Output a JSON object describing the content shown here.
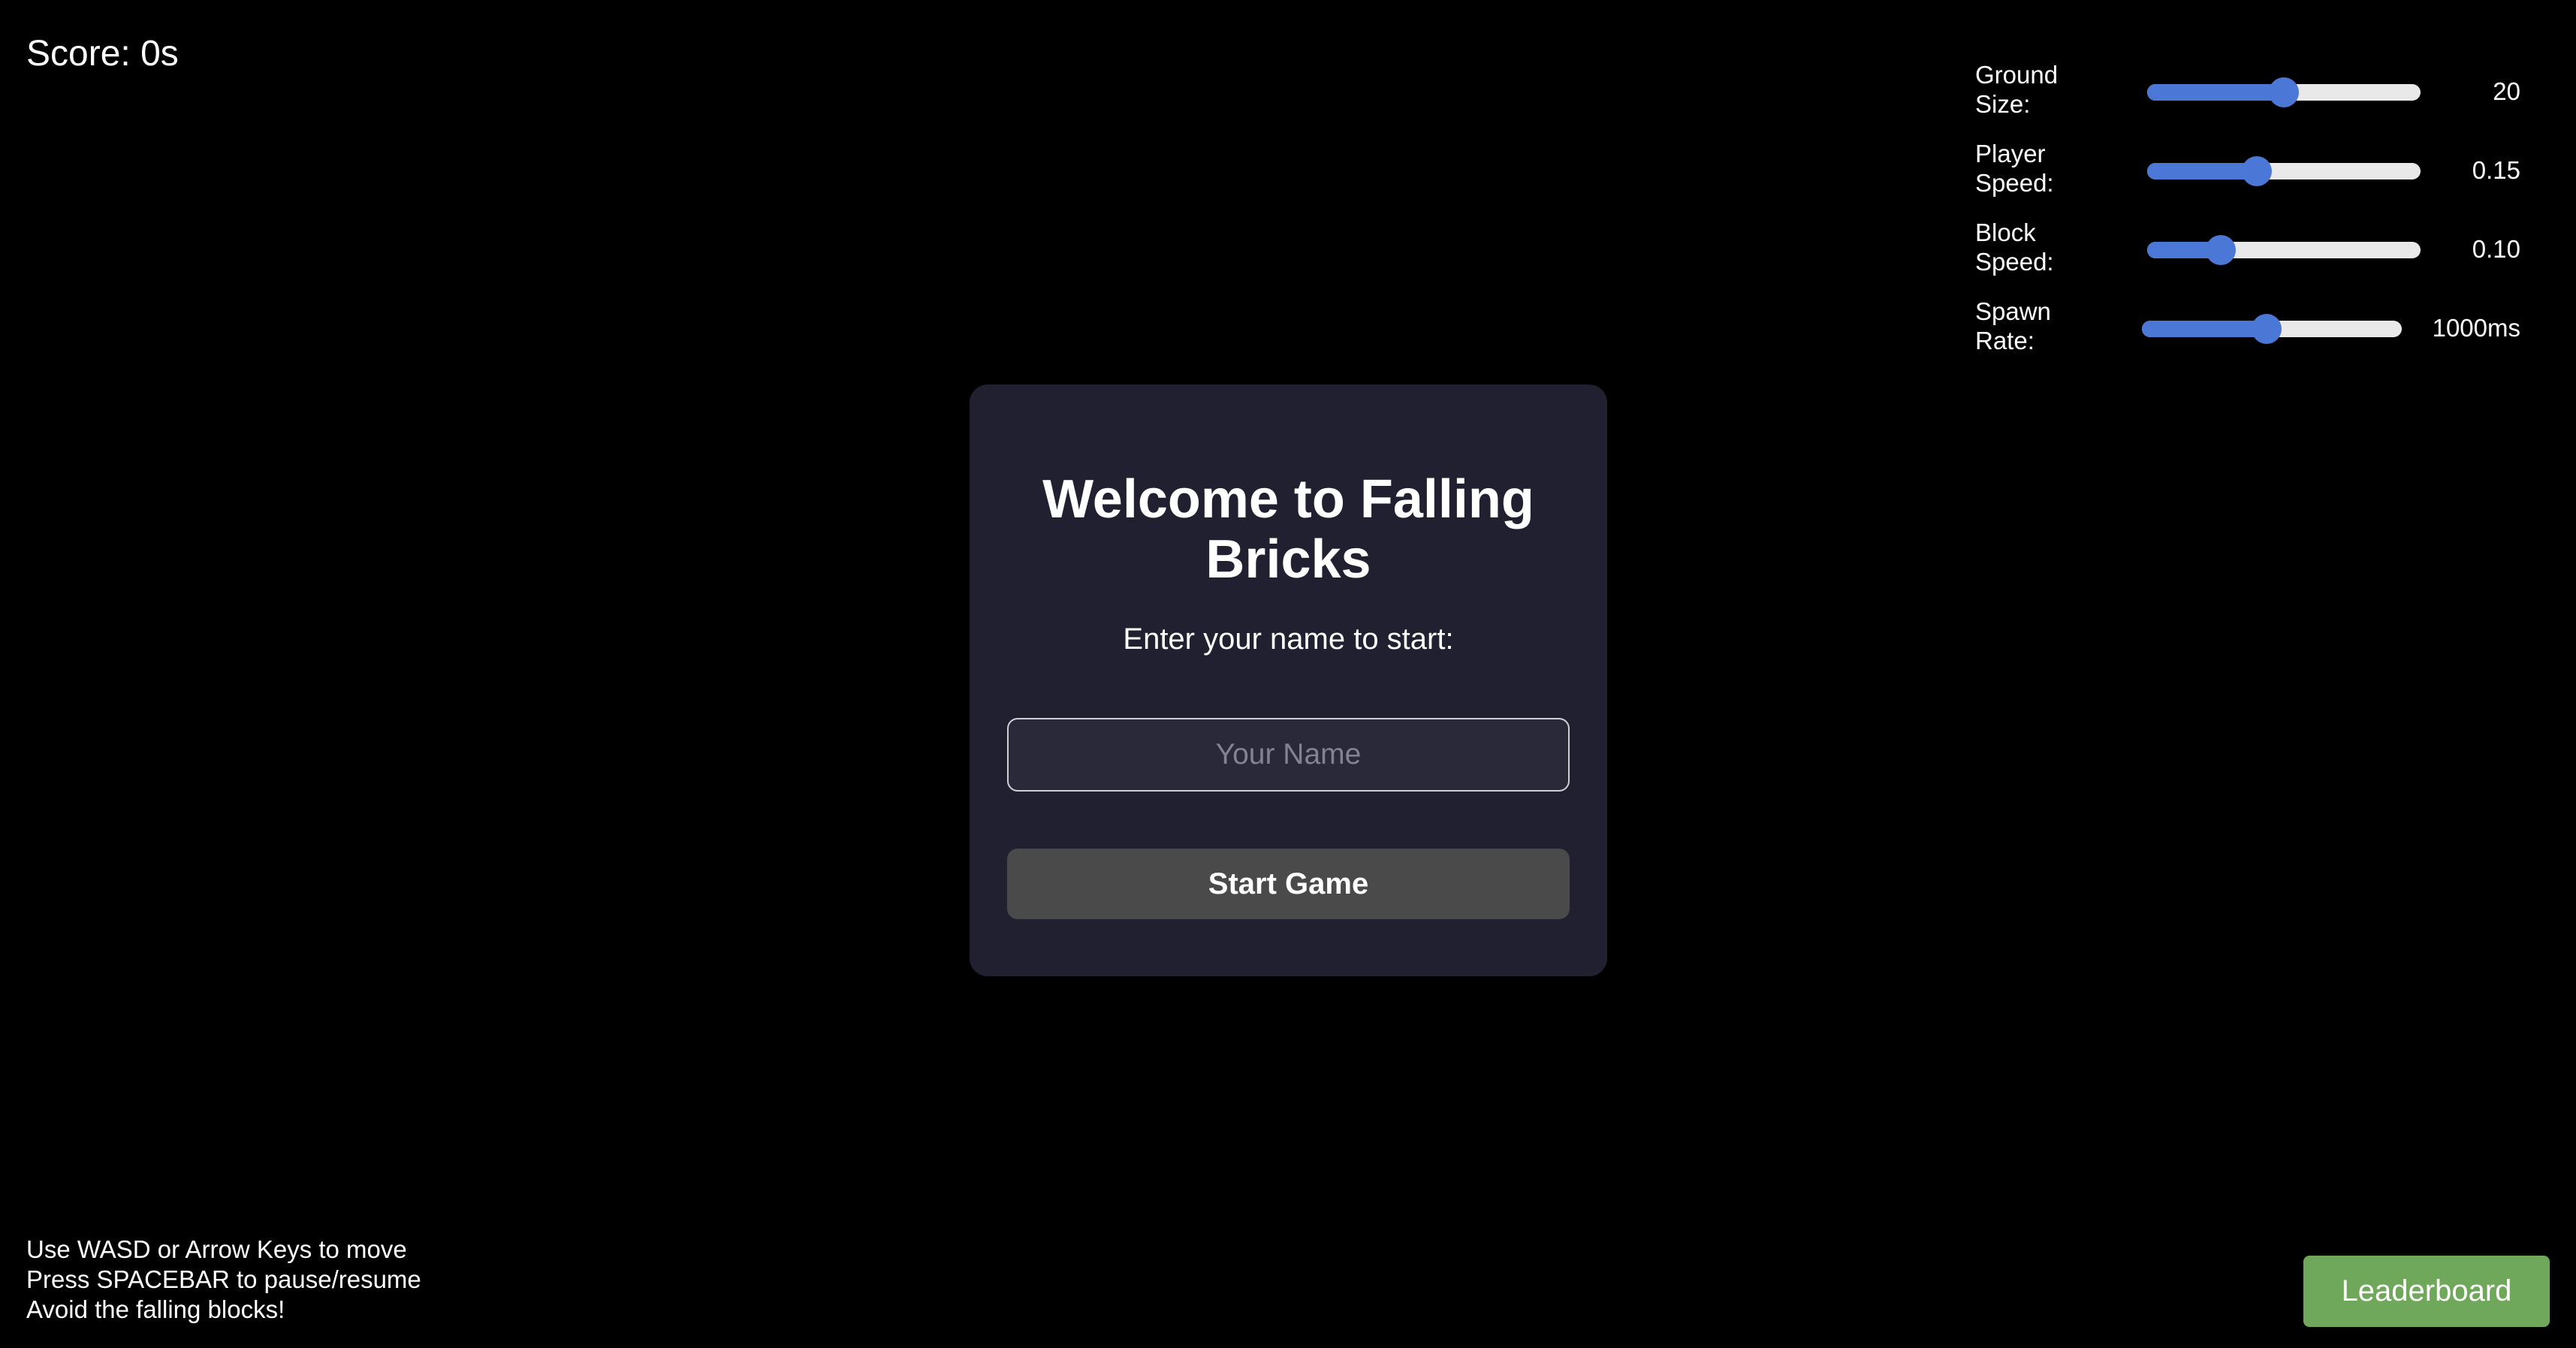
{
  "score": {
    "label": "Score: 0s"
  },
  "settings": [
    {
      "label": "Ground Size:",
      "value": "20",
      "fraction": 0.5,
      "icon": "slider"
    },
    {
      "label": "Player Speed:",
      "value": "0.15",
      "fraction": 0.4,
      "icon": "slider"
    },
    {
      "label": "Block Speed:",
      "value": "0.10",
      "fraction": 0.27,
      "icon": "slider"
    },
    {
      "label": "Spawn Rate:",
      "value": "1000ms",
      "fraction": 0.48,
      "icon": "slider"
    }
  ],
  "modal": {
    "title": "Welcome to Falling Bricks",
    "subtitle": "Enter your name to start:",
    "name_input": {
      "placeholder": "Your Name",
      "value": ""
    },
    "start_label": "Start Game"
  },
  "instructions": [
    "Use WASD or Arrow Keys to move",
    "Press SPACEBAR to pause/resume",
    "Avoid the falling blocks!"
  ],
  "leaderboard": {
    "label": "Leaderboard"
  },
  "colors": {
    "background": "#000000",
    "panel": "#202031",
    "slider_accent": "#4b78d6",
    "start_button": "#4a4a4a",
    "leaderboard_button": "#6fa85a"
  }
}
